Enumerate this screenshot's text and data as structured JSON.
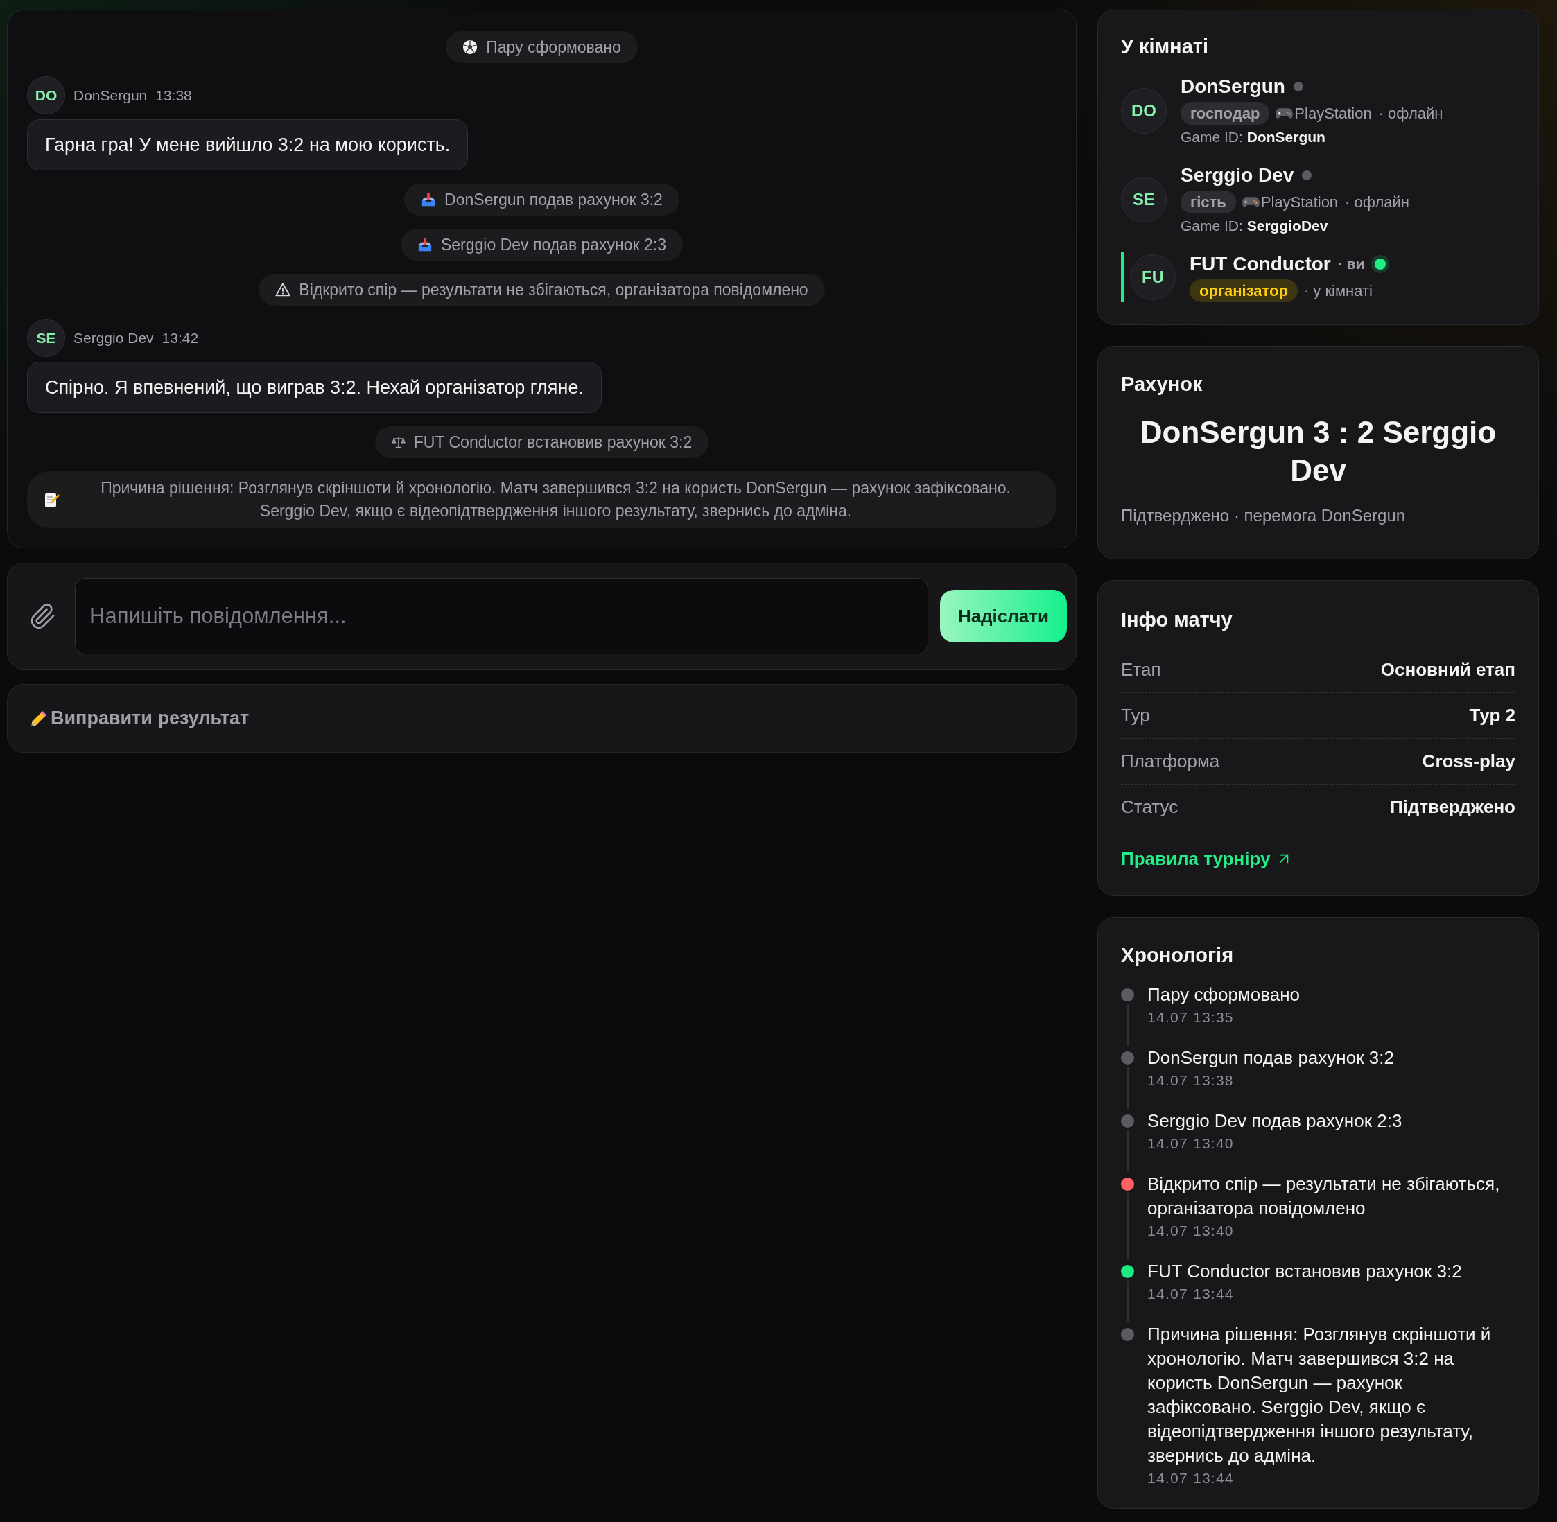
{
  "chat": {
    "feed": [
      {
        "kind": "paired",
        "text": "Пару сформовано"
      },
      {
        "kind": "message",
        "avatar": "DO",
        "author": "DonSergun",
        "time": "13:38",
        "text": "Гарна гра! У мене вийшло 3:2 на мою користь."
      },
      {
        "kind": "submitted",
        "text": "DonSergun подав рахунок 3:2"
      },
      {
        "kind": "submitted",
        "text": "Serggio Dev подав рахунок 2:3"
      },
      {
        "kind": "dispute",
        "text": "Відкрито спір — результати не збігаються, організатора повідомлено"
      },
      {
        "kind": "message",
        "avatar": "SE",
        "author": "Serggio Dev",
        "time": "13:42",
        "text": "Спірно. Я впевнений, що виграв 3:2. Нехай організатор гляне."
      },
      {
        "kind": "override",
        "text": "FUT Conductor встановив рахунок 3:2"
      },
      {
        "kind": "note",
        "text": "Причина рішення: Розглянув скріншоти й хронологію. Матч завершився 3:2 на користь DonSergun — рахунок зафіксовано. Serggio Dev, якщо є відеопідтвердження іншого результату, звернись до адміна."
      }
    ]
  },
  "composer": {
    "placeholder": "Напишіть повідомлення...",
    "send_button": "Надіслати"
  },
  "edit_result": {
    "label": "Виправити результат"
  },
  "room": {
    "title": "У кімнаті",
    "members": [
      {
        "avatar": "DO",
        "name": "DonSergun",
        "online": false,
        "current": false,
        "role": {
          "label": "господар",
          "highlighted": false
        },
        "platform": "PlayStation",
        "presence": "· офлайн",
        "game_id": "Game ID: **DonSergun**"
      },
      {
        "avatar": "SE",
        "name": "Serggio Dev",
        "online": false,
        "current": false,
        "role": {
          "label": "гість",
          "highlighted": false
        },
        "platform": "PlayStation",
        "presence": "· офлайн",
        "game_id": "Game ID: **SerggioDev**"
      },
      {
        "avatar": "FU",
        "name": "FUT Conductor",
        "you_label": "· ви",
        "online": true,
        "current": true,
        "role": {
          "label": "організатор",
          "highlighted": true
        },
        "presence": "· у кімнаті"
      }
    ]
  },
  "score": {
    "title": "Рахунок",
    "line": "DonSergun 3 : 2 Serggio Dev",
    "summary": "Підтверджено · перемога DonSergun"
  },
  "match_info": {
    "title": "Інфо матчу",
    "rows": [
      {
        "label": "Етап",
        "value": "Основний етап"
      },
      {
        "label": "Тур",
        "value": "Тур 2"
      },
      {
        "label": "Платформа",
        "value": "Cross-play"
      },
      {
        "label": "Статус",
        "value": "Підтверджено"
      }
    ],
    "link": "Правила турніру"
  },
  "timeline": {
    "title": "Хронологія",
    "events": [
      {
        "text": "Пару сформовано",
        "time": "14.07 13:35",
        "color": "#5b5b63"
      },
      {
        "text": "DonSergun подав рахунок 3:2",
        "time": "14.07 13:38",
        "color": "#5b5b63"
      },
      {
        "text": "Serggio Dev подав рахунок 2:3",
        "time": "14.07 13:40",
        "color": "#5b5b63"
      },
      {
        "text": "Відкрито спір — результати не збігаються, організатора повідомлено",
        "time": "14.07 13:40",
        "color": "#ff6262"
      },
      {
        "text": "FUT Conductor встановив рахунок 3:2",
        "time": "14.07 13:44",
        "color": "#1ee882"
      },
      {
        "text": "Причина рішення: Розглянув скріншоти й хронологію. Матч завершився 3:2 на користь DonSergun — рахунок зафіксовано. Serggio Dev, якщо є відеопідтвердження іншого результату, звернись до адміна.",
        "time": "14.07 13:44",
        "color": "#5b5b63"
      }
    ]
  }
}
